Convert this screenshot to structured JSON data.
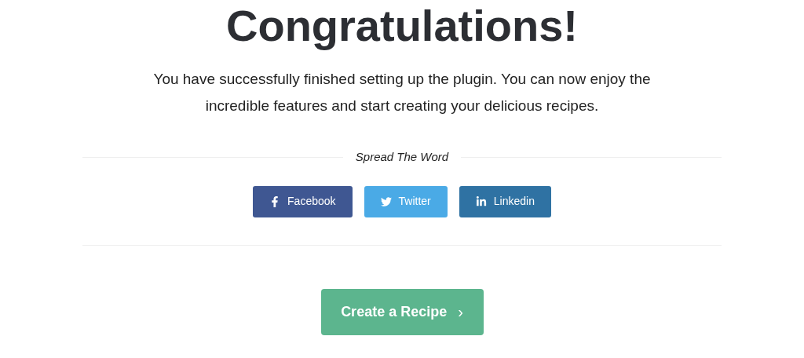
{
  "title": "Congratulations!",
  "message": "You have successfully finished setting up the plugin. You can now enjoy the incredible features and start creating your delicious recipes.",
  "share": {
    "heading": "Spread The Word",
    "buttons": [
      {
        "kind": "facebook",
        "label": "Facebook",
        "color": "#3f5792"
      },
      {
        "kind": "twitter",
        "label": "Twitter",
        "color": "#4aaae6"
      },
      {
        "kind": "linkedin",
        "label": "Linkedin",
        "color": "#2f72a3"
      }
    ]
  },
  "cta": {
    "label": "Create a Recipe",
    "arrow": "›"
  }
}
